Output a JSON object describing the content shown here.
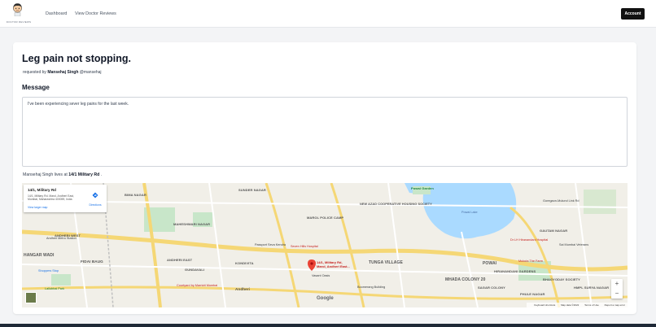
{
  "app": {
    "logo_text": "DOCTOR REVIEWS",
    "nav": [
      {
        "label": "Dashboard"
      },
      {
        "label": "View Doctor Reviews"
      }
    ],
    "account_label": "Account"
  },
  "request": {
    "title": "Leg pain not stopping.",
    "requested_by_prefix": "requested by",
    "requester_name": "Mansehaj Singh",
    "requester_handle": "@mansehaj",
    "message_heading": "Message",
    "message_text": "I've been experiencing sever leg pains for the last week.",
    "lives_prefix": "Mansehaj Singh lives at",
    "address": "14/1 Military Rd",
    "lives_suffix": "."
  },
  "map": {
    "info_title": "14/1, Military Rd",
    "info_address": "14/1, Military Rd, Marol, Andheri East, Mumbai, Maharashtra 400059, India",
    "directions_label": "Directions",
    "larger_map_label": "View larger map",
    "pin_label_line1": "14/1, Military Rd,",
    "pin_label_line2": "Marol, Andheri East...",
    "zoom_in": "+",
    "zoom_out": "−",
    "google_label": "Google",
    "footer": [
      "Keyboard shortcuts",
      "Map data ©2022",
      "Terms of Use",
      "Report a map error"
    ],
    "area_labels": [
      {
        "text": "ANDHERI EAST"
      },
      {
        "text": "KONDIVITA"
      },
      {
        "text": "TUNGA VILLAGE"
      },
      {
        "text": "HANGAR WADI"
      },
      {
        "text": "FIDAI BAUG"
      },
      {
        "text": "POWAI"
      },
      {
        "text": "GAUTAM NAGAR"
      },
      {
        "text": "HIRANANDANI GARDENS"
      },
      {
        "text": "MHADA COLONY 20"
      },
      {
        "text": "SAGAR COLONY"
      },
      {
        "text": "PHULE NAGAR"
      },
      {
        "text": "BHAGYODAY SOCIETY"
      },
      {
        "text": "HMPL SURYA NAGAR"
      },
      {
        "text": "NEW AZAD COOPERATIVE HOUSING SOCIETY"
      },
      {
        "text": "MAROL POLICE CAMP"
      },
      {
        "text": "SUNDER NAGAR"
      },
      {
        "text": "BIMA NAGAR"
      },
      {
        "text": "ANDHERI WEST"
      },
      {
        "text": "GUNDAVALI"
      },
      {
        "text": "Andheri"
      },
      {
        "text": "MAHESHWARI NAGAR"
      },
      {
        "text": "Powai Garden"
      }
    ],
    "poi_labels": [
      {
        "text": "Seven Hills Hospital",
        "color": "#c5221f"
      },
      {
        "text": "Passport Seva Kendra",
        "color": "#3c4043"
      },
      {
        "text": "Courtyard by Marriott Mumbai",
        "color": "#c5221f"
      },
      {
        "text": "Dr LH Hiranandani Hospital",
        "color": "#c5221f"
      },
      {
        "text": "Powai Lake",
        "color": "#4a6fa5"
      },
      {
        "text": "Lallubhai Park",
        "color": "#188038"
      },
      {
        "text": "Andheri Metro Station",
        "color": "#3c4043"
      },
      {
        "text": "Shoppers Stop",
        "color": "#1a73e8"
      },
      {
        "text": "Mukuta The Farm",
        "color": "#c5221f"
      },
      {
        "text": "Sai Mumbai Veterans",
        "color": "#3c4043"
      },
      {
        "text": "Goregaon-Mulund Link Rd",
        "color": "#3c4043"
      },
      {
        "text": "Boomerang Building",
        "color": "#3c4043"
      },
      {
        "text": "Vasant Oasis",
        "color": "#3c4043"
      }
    ]
  },
  "colors": {
    "water": "#aadaff",
    "park": "#c8e6c9",
    "road_major": "#f5d775",
    "road_minor": "#ffffff",
    "pin": "#ea4335",
    "account_bg": "#111111"
  }
}
